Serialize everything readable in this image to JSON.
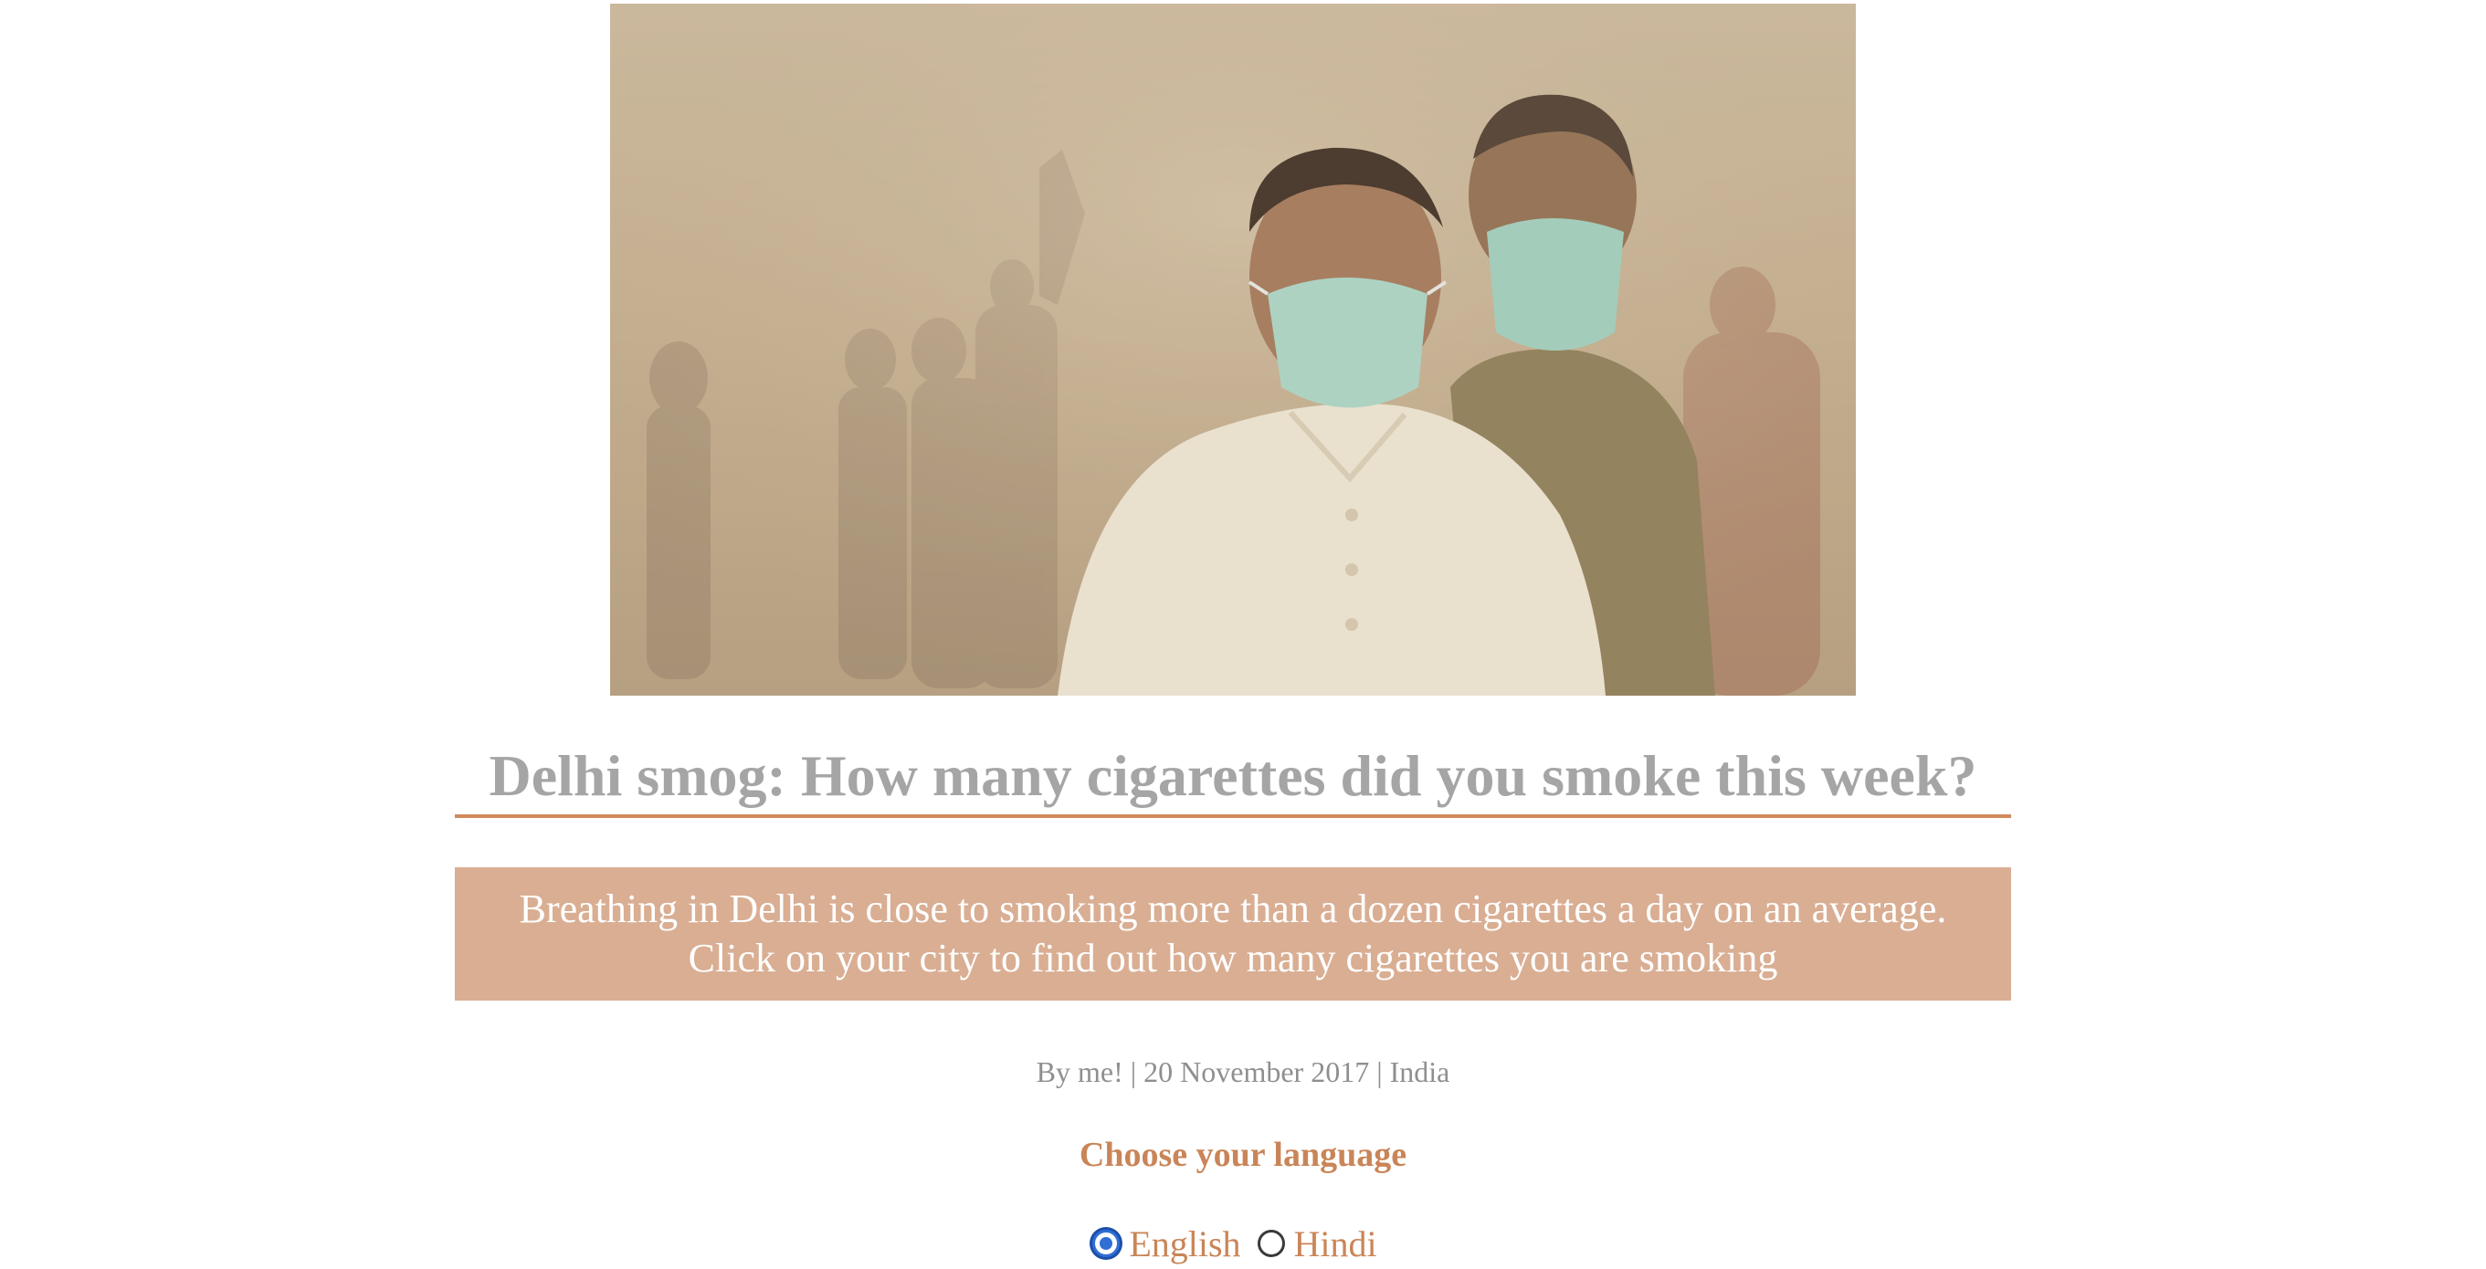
{
  "article": {
    "title": "Delhi smog: How many cigarettes did you smoke this week?",
    "subtitle_line1": "Breathing in Delhi is close to smoking more than a dozen cigarettes a day on an average.",
    "subtitle_line2": "Click on your city to find out how many cigarettes you are smoking",
    "byline": "By me! | 20 November 2017 | India"
  },
  "language": {
    "heading": "Choose your language",
    "options": [
      {
        "label": "English",
        "selected": true
      },
      {
        "label": "Hindi",
        "selected": false
      }
    ]
  },
  "colors": {
    "accent": "#d08a5c",
    "subtitle_bg": "#d9ae93",
    "title_text": "#a5a5a5",
    "radio_selected": "#2f6fd6"
  }
}
